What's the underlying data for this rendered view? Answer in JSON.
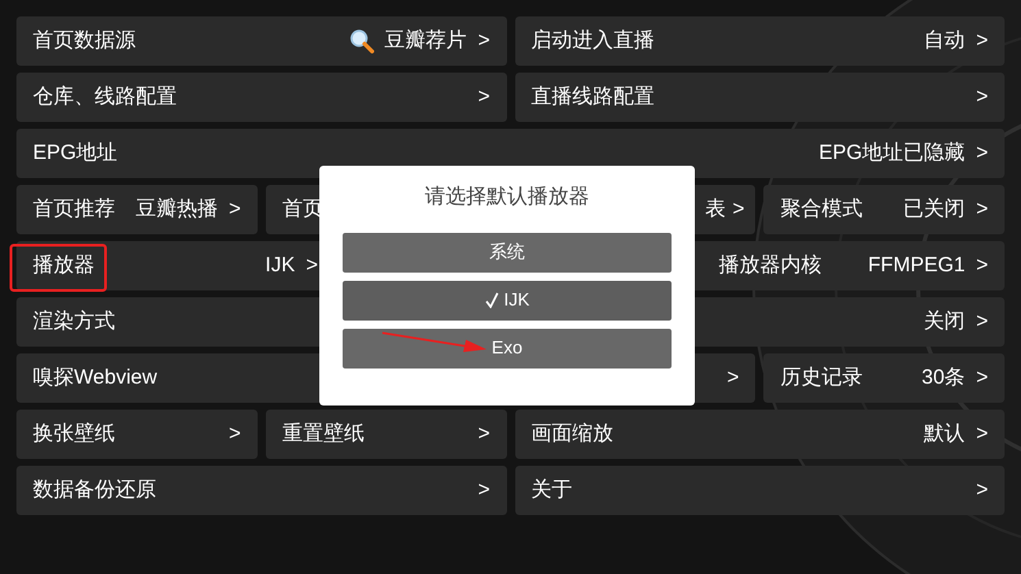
{
  "settings_rows": [
    [
      {
        "kind": "plain",
        "label": "首页数据源",
        "value": "豆瓣荐片",
        "arrow": ">",
        "search": true
      },
      {
        "kind": "plain",
        "label": "启动进入直播",
        "value": "自动",
        "arrow": ">"
      }
    ],
    [
      {
        "kind": "plain",
        "label": "仓库、线路配置",
        "arrow": ">"
      },
      {
        "kind": "plain",
        "label": "直播线路配置",
        "arrow": ">"
      }
    ],
    [
      {
        "kind": "plain",
        "label": "EPG地址",
        "value": "EPG地址已隐藏",
        "arrow": ">"
      }
    ],
    [
      {
        "kind": "plain",
        "label": "首页推荐",
        "value": "豆瓣热播",
        "arrow": ">"
      },
      {
        "kind": "plain",
        "label": "首页"
      },
      {
        "kind": "plain",
        "value": "表",
        "arrow": ">"
      },
      {
        "kind": "plain",
        "label": "聚合模式",
        "value": "已关闭",
        "arrow": ">"
      }
    ],
    [
      {
        "kind": "highlighted",
        "label": "播放器",
        "value": "IJK",
        "arrow": ">"
      },
      {
        "kind": "plain",
        "label": "播放器内核",
        "value": "FFMPEG1",
        "arrow": ">"
      }
    ],
    [
      {
        "kind": "plain",
        "label": "渲染方式",
        "value": "关闭",
        "arrow": ">"
      }
    ],
    [
      {
        "kind": "plain",
        "label": "嗅探Webview",
        "arrow": ">"
      },
      {
        "kind": "plain",
        "label": "历史记录",
        "value": "30条",
        "arrow": ">"
      }
    ],
    [
      {
        "kind": "plain",
        "label": "换张壁纸",
        "arrow": ">"
      },
      {
        "kind": "plain",
        "label": "重置壁纸",
        "arrow": ">"
      },
      {
        "kind": "plain",
        "label": "画面缩放",
        "value": "默认",
        "arrow": ">"
      }
    ],
    [
      {
        "kind": "plain",
        "label": "数据备份还原",
        "arrow": ">"
      },
      {
        "kind": "plain",
        "label": "关于",
        "arrow": ">"
      }
    ]
  ],
  "dialog": {
    "title": "请选择默认播放器",
    "options": [
      {
        "label": "系统",
        "selected": false,
        "pointed": false
      },
      {
        "label": "IJK",
        "selected": true,
        "pointed": false
      },
      {
        "label": "Exo",
        "selected": false,
        "pointed": true
      }
    ]
  }
}
